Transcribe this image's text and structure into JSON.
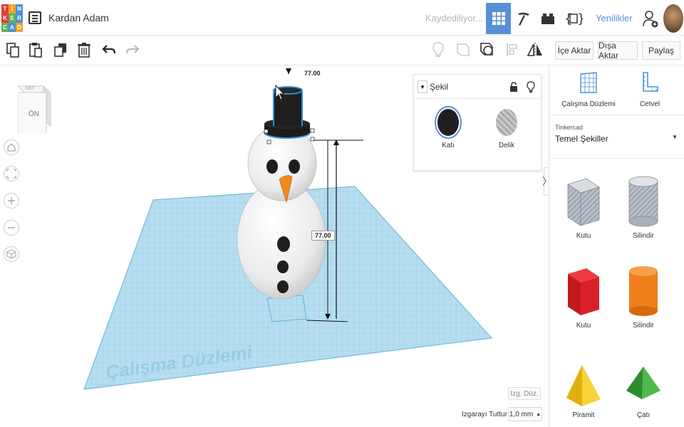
{
  "header": {
    "logo_letters": [
      "T",
      "I",
      "N",
      "K",
      "E",
      "R",
      "C",
      "A",
      "D"
    ],
    "logo_colors": [
      "#e93b3a",
      "#f6a21e",
      "#4a90d9",
      "#e93b3a",
      "#5ab35a",
      "#4a90d9",
      "#5ab35a",
      "#4a90d9",
      "#f6a21e"
    ],
    "design_title": "Kardan Adam",
    "save_status": "Kaydediliyor...",
    "news_label": "Yenilikler",
    "active_color": "#5a8fd6"
  },
  "toolbar": {
    "import_label": "İçe Aktar",
    "export_label": "Dışa Aktar",
    "share_label": "Paylaş"
  },
  "canvas": {
    "viewcube_face": "ÖN",
    "viewcube_top": "ÜST",
    "workplane_label": "Çalışma Düzlemi",
    "dimension_top": "77.00",
    "dimension_height": "77.00",
    "edit_grid_label": "Izg. Düz.",
    "snap_grid_label": "Izgarayı Tuttur",
    "snap_grid_value": "1,0 mm"
  },
  "inspector": {
    "title": "Şekil",
    "solid_label": "Katı",
    "hole_label": "Delik"
  },
  "right_panel": {
    "workplane_label": "Çalışma Düzlemi",
    "ruler_label": "Cetvel",
    "library_category": "Tinkercad",
    "library_name": "Temel Şekiller",
    "shapes": [
      {
        "label": "Kutu",
        "color": "#a9b3bf"
      },
      {
        "label": "Silindir",
        "color": "#b8bec6"
      },
      {
        "label": "Kutu",
        "color": "#d8202a"
      },
      {
        "label": "Silindir",
        "color": "#ee7f1a"
      },
      {
        "label": "Piramit",
        "color": "#f2c81c"
      },
      {
        "label": "Çatı",
        "color": "#3aa43a"
      }
    ]
  }
}
